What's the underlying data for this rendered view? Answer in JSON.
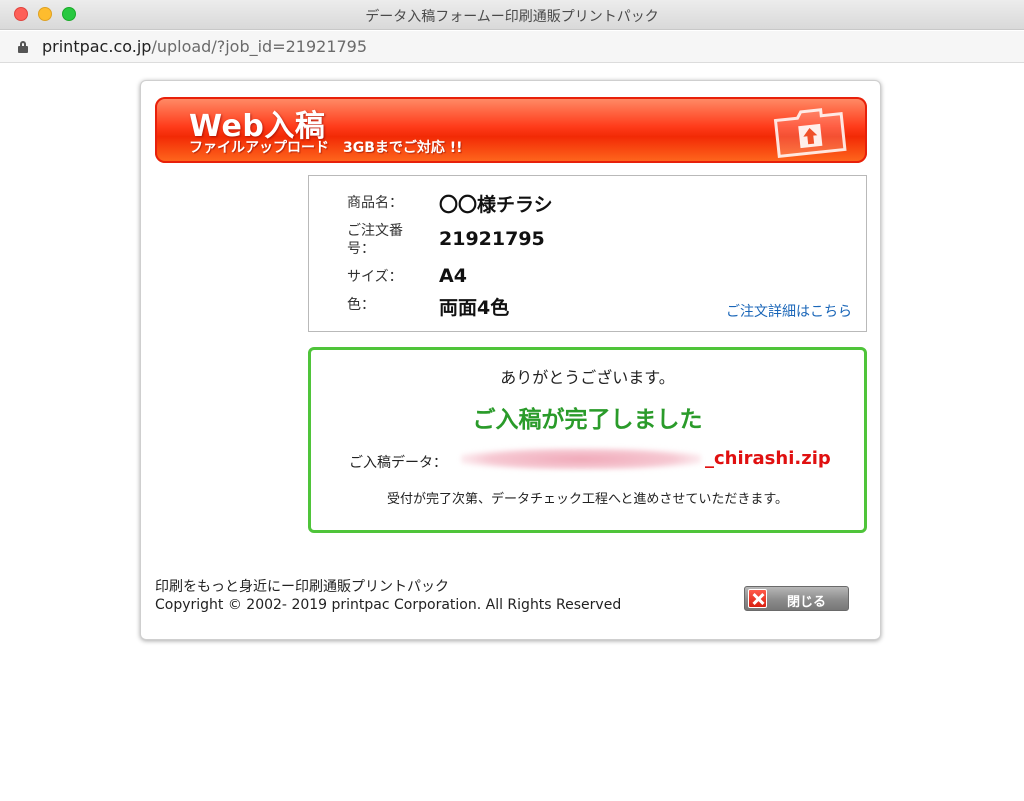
{
  "window": {
    "title": "データ入稿フォームー印刷通販プリントパック",
    "url_host": "printpac.co.jp",
    "url_path": "/upload/?job_id=21921795"
  },
  "banner": {
    "title": "Web入稿",
    "subtitle": "ファイルアップロード　3GBまでご対応 !!"
  },
  "order": {
    "product_label": "商品名：",
    "product_value": "〇〇様チラシ",
    "number_label": "ご注文番号：",
    "number_value": "21921795",
    "size_label": "サイズ：",
    "size_value": "A4",
    "color_label": "色：",
    "color_value": "両面4色",
    "detail_link": "ご注文詳細はこちら"
  },
  "complete": {
    "thanks": "ありがとうございます。",
    "message": "ご入稿が完了しました",
    "file_label": "ご入稿データ：",
    "file_name": "_chirashi.zip",
    "note": "受付が完了次第、データチェック工程へと進めさせていただきます。"
  },
  "footer": {
    "tagline": "印刷をもっと身近にー印刷通販プリントパック",
    "copyright": "Copyright © 2002- 2019 printpac Corporation. All Rights Reserved",
    "close_label": "閉じる"
  },
  "colors": {
    "accent_red": "#f22a05",
    "success_green": "#4fc43a",
    "link_blue": "#1a66b8",
    "file_red": "#e01010"
  }
}
